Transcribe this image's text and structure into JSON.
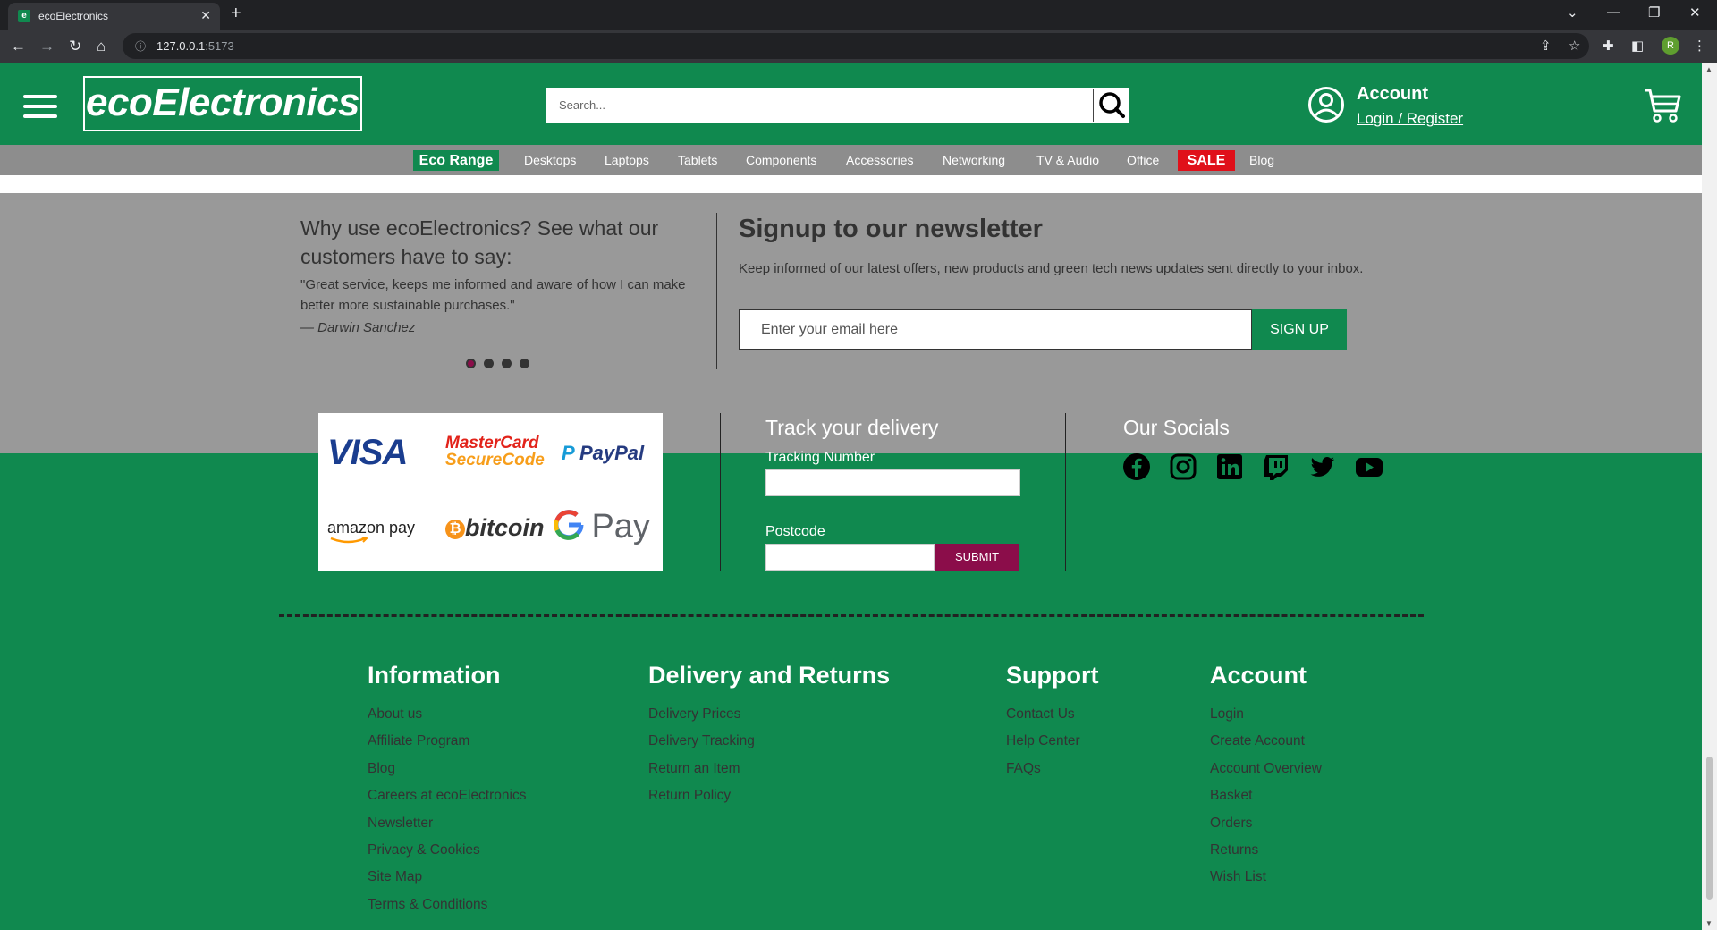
{
  "browser": {
    "tab_title": "ecoElectronics",
    "tab_favicon_letter": "e",
    "url_host": "127.0.0.1",
    "url_port": ":5173",
    "profile_initial": "R"
  },
  "header": {
    "logo": "ecoElectronics",
    "search_placeholder": "Search...",
    "account_title": "Account",
    "account_link": "Login / Register"
  },
  "categories": {
    "eco_range": "Eco Range",
    "items": [
      "Desktops",
      "Laptops",
      "Tablets",
      "Components",
      "Accessories",
      "Networking",
      "TV & Audio",
      "Office"
    ],
    "sale": "SALE",
    "blog": "Blog"
  },
  "testimonial": {
    "heading": "Why use ecoElectronics? See what our customers have to say:",
    "quote": "\"Great service, keeps me informed and aware of how I can make better more sustainable purchases.\"",
    "author": "— Darwin Sanchez",
    "dots_count": 4,
    "active_dot": 0
  },
  "newsletter": {
    "heading": "Signup to our newsletter",
    "text": "Keep informed of our latest offers, new products and green tech news updates sent directly to your inbox.",
    "email_placeholder": "Enter your email here",
    "button": "SIGN UP"
  },
  "payments": {
    "visa": "VISA",
    "mastercard_line1": "MasterCard",
    "mastercard_line2": "SecureCode",
    "paypal": "PayPal",
    "amazon": "amazon pay",
    "bitcoin": "bitcoin",
    "gpay": "Pay"
  },
  "tracking": {
    "heading": "Track your delivery",
    "number_label": "Tracking Number",
    "postcode_label": "Postcode",
    "submit": "SUBMIT"
  },
  "socials": {
    "heading": "Our Socials",
    "icons": [
      "facebook-icon",
      "instagram-icon",
      "linkedin-icon",
      "twitch-icon",
      "twitter-icon",
      "youtube-icon"
    ]
  },
  "footer": {
    "columns": [
      {
        "heading": "Information",
        "links": [
          "About us",
          "Affiliate Program",
          "Blog",
          "Careers at ecoElectronics",
          "Newsletter",
          "Privacy & Cookies",
          "Site Map",
          "Terms & Conditions"
        ]
      },
      {
        "heading": "Delivery and Returns",
        "links": [
          "Delivery Prices",
          "Delivery Tracking",
          "Return an Item",
          "Return Policy"
        ]
      },
      {
        "heading": "Support",
        "links": [
          "Contact Us",
          "Help Center",
          "FAQs"
        ]
      },
      {
        "heading": "Account",
        "links": [
          "Login",
          "Create Account",
          "Account Overview",
          "Basket",
          "Orders",
          "Returns",
          "Wish List"
        ]
      }
    ]
  },
  "colors": {
    "brand_green": "#10894f",
    "sale_red": "#e0101a",
    "accent_maroon": "#8b0d4a",
    "grey_band": "#999999"
  }
}
